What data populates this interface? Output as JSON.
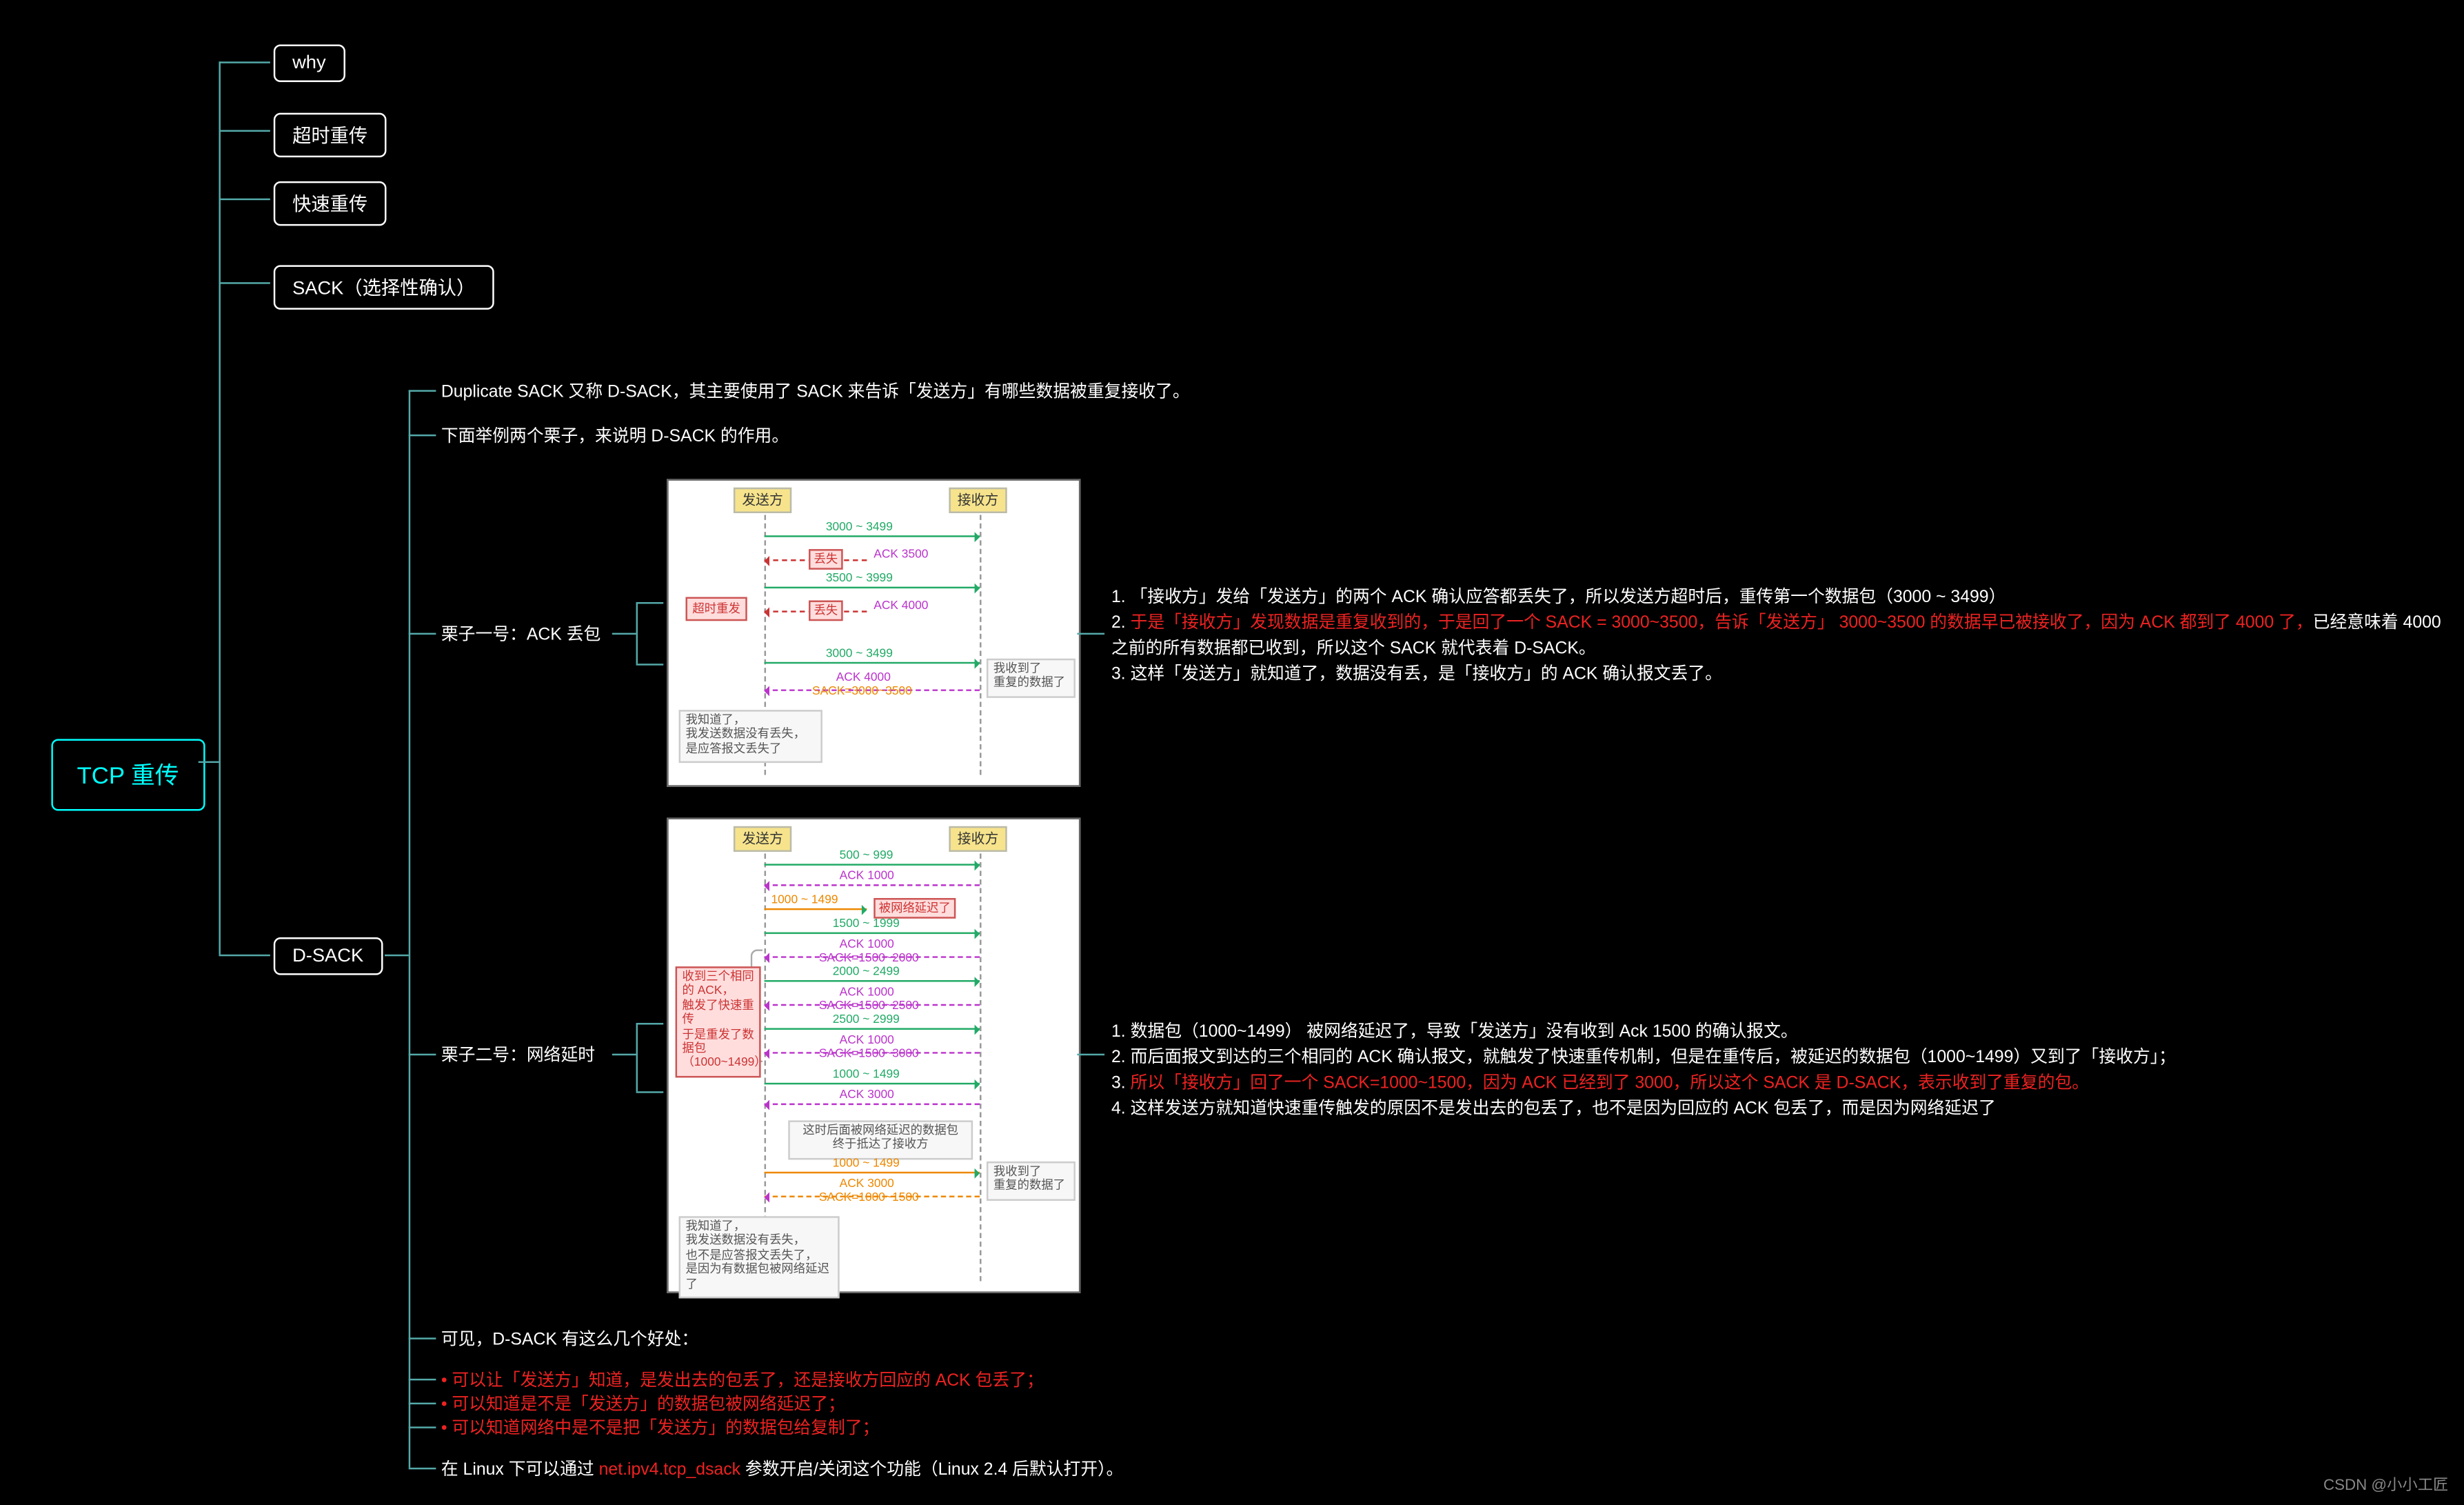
{
  "root": "TCP 重传",
  "nodes": {
    "why": "why",
    "timeout": "超时重传",
    "fast": "快速重传",
    "sack": "SACK（选择性确认）",
    "dsack": "D-SACK",
    "case1": "栗子一号：ACK 丢包",
    "case2": "栗子二号：网络延时"
  },
  "dsack_intro": {
    "l1": "Duplicate SACK 又称 D-SACK，其主要使用了 SACK 来告诉「发送方」有哪些数据被重复接收了。",
    "l2": "下面举例两个栗子，来说明 D-SACK 的作用。"
  },
  "case1_text": {
    "l1": "「接收方」发给「发送方」的两个 ACK 确认应答都丢失了，所以发送方超时后，重传第一个数据包（3000 ~ 3499）",
    "l2a": "于是「接收方」发现数据是重复收到的，于是回了一个 SACK = 3000~3500，告诉「发送方」 3000~3500 的数据早已被接收了，因为 ACK 都到了 4000 了，",
    "l2b": "已经意味着 4000 之前的所有数据都已收到，所以这个 SACK 就代表着 D-SACK。",
    "l3": "这样「发送方」就知道了，数据没有丢，是「接收方」的 ACK 确认报文丢了。"
  },
  "case2_text": {
    "l1": "数据包（1000~1499） 被网络延迟了，导致「发送方」没有收到 Ack 1500 的确认报文。",
    "l2": "而后面报文到达的三个相同的 ACK 确认报文，就触发了快速重传机制，但是在重传后，被延迟的数据包（1000~1499）又到了「接收方」；",
    "l3": "所以「接收方」回了一个 SACK=1000~1500，因为 ACK 已经到了 3000，所以这个 SACK 是 D-SACK，表示收到了重复的包。",
    "l4": "这样发送方就知道快速重传触发的原因不是发出去的包丢了，也不是因为回应的 ACK 包丢了，而是因为网络延迟了"
  },
  "benefits_hdr": "可见，D-SACK 有这么几个好处：",
  "benefits": {
    "b1": "可以让「发送方」知道，是发出去的包丢了，还是接收方回应的 ACK 包丢了；",
    "b2": "可以知道是不是「发送方」的数据包被网络延迟了；",
    "b3": "可以知道网络中是不是把「发送方」的数据包给复制了；"
  },
  "linux_note_a": "在 Linux 下可以通过 ",
  "linux_note_b": "net.ipv4.tcp_dsack",
  "linux_note_c": " 参数开启/关闭这个功能（Linux 2.4 后默认打开）。",
  "watermark": "CSDN @小小工匠",
  "chart_data": {
    "fig1": {
      "sender": "发送方",
      "receiver": "接收方",
      "retry": "超时重发",
      "rows": [
        {
          "t": "r",
          "lbl": "3000 ~ 3499"
        },
        {
          "t": "lost",
          "lbl": "ACK 3500",
          "tag": "丢失"
        },
        {
          "t": "r",
          "lbl": "3500 ~ 3999"
        },
        {
          "t": "lost",
          "lbl": "ACK 4000",
          "tag": "丢失"
        },
        {
          "t": "r",
          "lbl": "3000 ~ 3499"
        },
        {
          "t": "l",
          "lbl": "ACK 4000",
          "sub": "SACK=3000~3500"
        }
      ],
      "note_left": "我知道了，\n我发送数据没有丢失，\n是应答报文丢失了",
      "note_right": "我收到了\n重复的数据了"
    },
    "fig2": {
      "sender": "发送方",
      "receiver": "接收方",
      "rows": [
        {
          "t": "r",
          "lbl": "500 ~ 999"
        },
        {
          "t": "l",
          "lbl": "ACK 1000"
        },
        {
          "t": "delay",
          "lbl": "1000 ~ 1499",
          "tag": "被网络延迟了"
        },
        {
          "t": "r",
          "lbl": "1500 ~ 1999"
        },
        {
          "t": "l",
          "lbl": "ACK 1000",
          "sub": "SACK=1500~2000"
        },
        {
          "t": "r",
          "lbl": "2000 ~ 2499"
        },
        {
          "t": "l",
          "lbl": "ACK 1000",
          "sub": "SACK=1500~2500"
        },
        {
          "t": "r",
          "lbl": "2500 ~ 2999"
        },
        {
          "t": "l",
          "lbl": "ACK 1000",
          "sub": "SACK=1500~3000"
        },
        {
          "t": "r",
          "lbl": "1000 ~ 1499"
        },
        {
          "t": "l",
          "lbl": "ACK 3000"
        },
        {
          "t": "b",
          "lbl": "这时后面被网络延迟的数据包\n终于抵达了接收方"
        },
        {
          "t": "r",
          "lbl": "1000 ~ 1499",
          "orange": true
        },
        {
          "t": "l",
          "lbl": "ACK 3000",
          "sub": "SACK=1000~1500",
          "orange": true
        }
      ],
      "brace_note": "收到三个相同的 ACK，\n触发了快速重传\n于是重发了数据包\n（1000~1499）",
      "note_left": "我知道了，\n我发送数据没有丢失，\n也不是应答报文丢失了，\n是因为有数据包被网络延迟了",
      "note_right": "我收到了\n重复的数据了"
    }
  }
}
